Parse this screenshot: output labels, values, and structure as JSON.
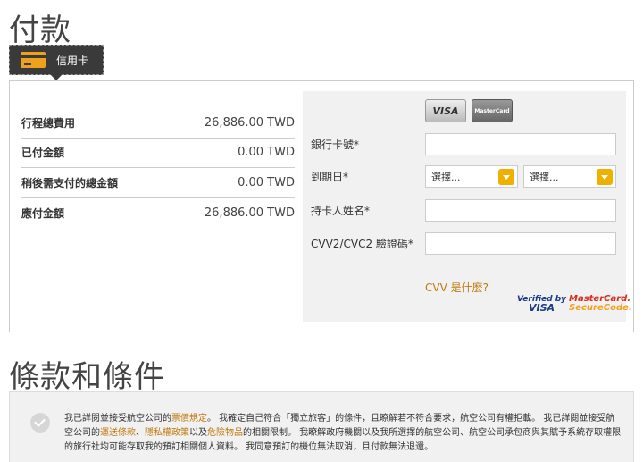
{
  "page_title": "付款",
  "payment_tab": {
    "label": "信用卡",
    "icon": "credit-card-icon"
  },
  "summary": [
    {
      "label": "行程總費用",
      "value": "26,886.00 TWD"
    },
    {
      "label": "已付金額",
      "value": "0.00 TWD"
    },
    {
      "label": "稍後需支付的總金額",
      "value": "0.00 TWD"
    },
    {
      "label": "應付金額",
      "value": "26,886.00 TWD"
    }
  ],
  "card_form": {
    "logos": {
      "visa": "VISA",
      "mastercard": "MasterCard"
    },
    "card_number_label": "銀行卡號*",
    "expiry_label": "到期日*",
    "expiry_month_value": "選擇...",
    "expiry_year_value": "選擇...",
    "holder_name_label": "持卡人姓名*",
    "cvv_label": "CVV2/CVC2 驗證碼*",
    "cvv_help_link": "CVV 是什麼?",
    "verified_by_visa": {
      "line1": "Verified by",
      "line2": "VISA"
    },
    "mastercard_securecode": {
      "line1": "MasterCard.",
      "line2": "SecureCode."
    }
  },
  "terms": {
    "title": "條款和條件",
    "text_1": "我已詳閱並接受航空公司的",
    "link_fare_rules": "票價規定",
    "text_2": "。 我確定自己符合「獨立旅客」的條件，且瞭解若不符合要求，航空公司有權拒載。 我已詳閱並接受航空公司的",
    "link_conditions": "運送條款",
    "text_3": "、",
    "link_privacy": "隱私權政策",
    "text_4": "以及",
    "link_dangerous": "危險物品",
    "text_5": "的相關限制。 我瞭解政府機關以及我所選擇的航空公司、航空公司承包商與其賦予系統存取權限的旅行社均可能存取我的預訂相關個人資料。 我同意預訂的機位無法取消，且付款無法退還。"
  },
  "colors": {
    "accent": "#f0a11c",
    "link": "#c07a10",
    "tab_bg": "#3a3a3a"
  }
}
